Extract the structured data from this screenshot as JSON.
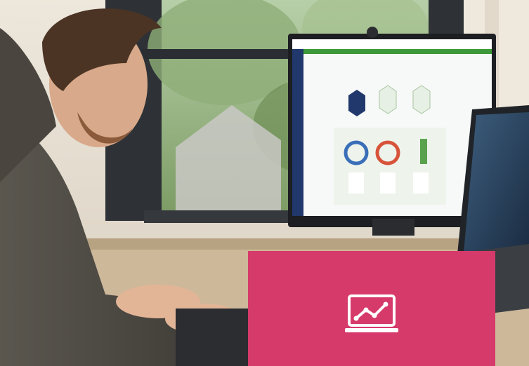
{
  "photo": {
    "subject": "person-at-computer-icon",
    "accent_color": "#d63a6b"
  },
  "tile": {
    "icon": "analytics-monitor-icon",
    "color": "#d63a6b",
    "icon_color": "#ffffff"
  }
}
